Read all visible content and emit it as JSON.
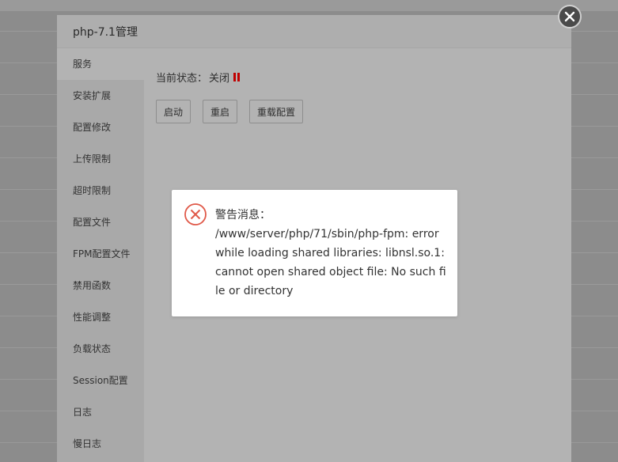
{
  "modal": {
    "title": "php-7.1管理",
    "sidebar": {
      "items": [
        {
          "label": "服务"
        },
        {
          "label": "安装扩展"
        },
        {
          "label": "配置修改"
        },
        {
          "label": "上传限制"
        },
        {
          "label": "超时限制"
        },
        {
          "label": "配置文件"
        },
        {
          "label": "FPM配置文件"
        },
        {
          "label": "禁用函数"
        },
        {
          "label": "性能调整"
        },
        {
          "label": "负载状态"
        },
        {
          "label": "Session配置"
        },
        {
          "label": "日志"
        },
        {
          "label": "慢日志"
        }
      ],
      "active_index": 0
    },
    "service": {
      "status_label": "当前状态：",
      "status_value": "关闭",
      "status_icon": "stop-icon",
      "buttons": {
        "start": "启动",
        "restart": "重启",
        "reload": "重载配置"
      }
    },
    "close_icon": "close-icon"
  },
  "alert": {
    "icon": "error-circle-icon",
    "title": "警告消息：",
    "message": "/www/server/php/71/sbin/php-fpm: error while loading shared libraries: libnsl.so.1: cannot open shared object file: No such file or directory"
  },
  "colors": {
    "stop_red": "#c00000",
    "error_red": "#e05a4a"
  }
}
